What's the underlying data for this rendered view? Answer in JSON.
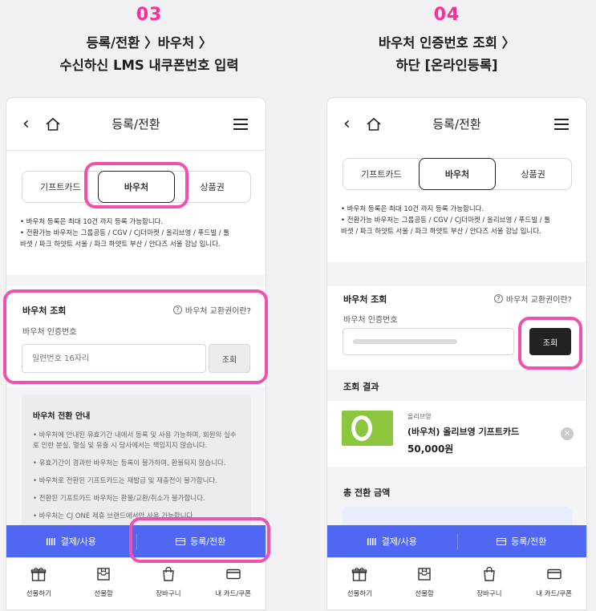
{
  "steps": {
    "left": {
      "number": "03",
      "line1": "등록/전환 〉바우처 〉",
      "line2": "수신하신 LMS 내쿠폰번호 입력"
    },
    "right": {
      "number": "04",
      "line1": "바우처 인증번호 조회 〉",
      "line2": "하단 [온라인등록]"
    }
  },
  "header": {
    "title": "등록/전환"
  },
  "tabs": [
    "기프트카드",
    "바우처",
    "상품권"
  ],
  "notes": {
    "n1": "• 바우처 등록은 최대 10건 까지 등록 가능합니다.",
    "n2": "• 전환가능 바우처는 그룹공동 / CGV / CJ더마켓 / 올리브영 / 푸드빌 / 톨",
    "n3": "  바셋 / 파크 하얏트 서울 / 파크 하얏트 부산 / 안다즈 서울 강남 입니다."
  },
  "voucher_search": {
    "title": "바우처 조회",
    "help": "바우처 교환권이란?",
    "label": "바우처 인증번호",
    "placeholder": "일련번호 16자리",
    "button": "조회"
  },
  "guide": {
    "title": "바우처 전환 안내",
    "items": [
      "• 바우처에 안내된 유효기간 내에서 등록 및 사용 가능하며, 회원의 실수로 인한 분실, 멸실 및 유출 시 당사에서는 책임지지 않습니다.",
      "• 유효기간이 경과한 바우처는 등록이 불가하며, 환불되지 않습니다.",
      "• 바우처로 전환된 기프트카드는 재발급 및 재충전이 불가합니다.",
      "• 전환된 기프트카드 바우처는 환불/교환/취소가 불가합니다.",
      "• 바우처는 CJ ONE 제휴 브랜드에서만 사용 가능합니다."
    ]
  },
  "result": {
    "title": "조회 결과",
    "brand": "올리브영",
    "product": "(바우처) 올리브영 기프트카드",
    "price": "50,000원",
    "remove": "×"
  },
  "total": {
    "title": "총 전환 금액"
  },
  "actions": {
    "pay": "결제/사용",
    "register": "등록/전환"
  },
  "nav": [
    "선물하기",
    "선물함",
    "장바구니",
    "내 카드/쿠폰"
  ],
  "colors": {
    "highlight": "#f24fae",
    "accent": "#4f67f3",
    "step_number": "#ff2d9a"
  }
}
